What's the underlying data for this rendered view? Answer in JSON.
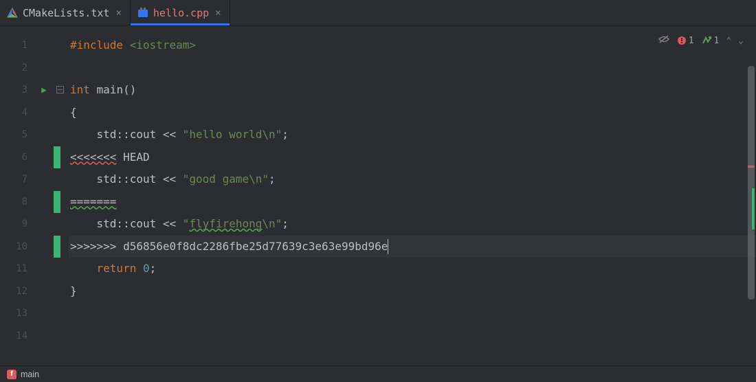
{
  "tabs": [
    {
      "label": "CMakeLists.txt",
      "active": false
    },
    {
      "label": "hello.cpp",
      "active": true
    }
  ],
  "inspections": {
    "error_count": "1",
    "warning_count": "1"
  },
  "status": {
    "branch": "main"
  },
  "code": {
    "line1": {
      "include": "#include",
      "header": "<iostream>"
    },
    "line3": {
      "int": "int",
      "main": " main()"
    },
    "line4": "{",
    "line5": {
      "prefix": "    std::cout << ",
      "str": "\"hello world\\n\"",
      "suffix": ";"
    },
    "line6": {
      "markers": "<<<<<<<",
      "label": " HEAD"
    },
    "line7": {
      "prefix": "    std::cout << ",
      "str": "\"good game\\n\"",
      "suffix": ";"
    },
    "line8": "=======",
    "line9": {
      "prefix": "    std::cout << ",
      "q1": "\"",
      "word": "flyfirehong",
      "q2": "\\n\"",
      "suffix": ";"
    },
    "line10": {
      "markers": ">>>>>>>",
      "hash": " d56856e0f8dc2286fbe25d77639c3e63e99bd96e"
    },
    "line11": {
      "ret": "    return ",
      "zero": "0",
      "semi": ";"
    },
    "line12": "}"
  },
  "line_numbers": [
    "1",
    "2",
    "3",
    "4",
    "5",
    "6",
    "7",
    "8",
    "9",
    "10",
    "11",
    "12",
    "13",
    "14"
  ]
}
